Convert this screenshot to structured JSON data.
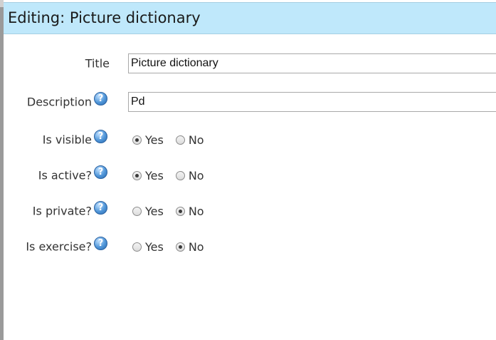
{
  "header": {
    "title": "Editing: Picture dictionary"
  },
  "form": {
    "title": {
      "label": "Title",
      "value": "Picture dictionary"
    },
    "description": {
      "label": "Description",
      "value": "Pd"
    },
    "is_visible": {
      "label": "Is visible",
      "yes": "Yes",
      "no": "No",
      "selected": "Yes"
    },
    "is_active": {
      "label": "Is active?",
      "yes": "Yes",
      "no": "No",
      "selected": "Yes"
    },
    "is_private": {
      "label": "Is private?",
      "yes": "Yes",
      "no": "No",
      "selected": "No"
    },
    "is_exercise": {
      "label": "Is exercise?",
      "yes": "Yes",
      "no": "No",
      "selected": "No"
    }
  },
  "icons": {
    "help": "help-icon"
  }
}
